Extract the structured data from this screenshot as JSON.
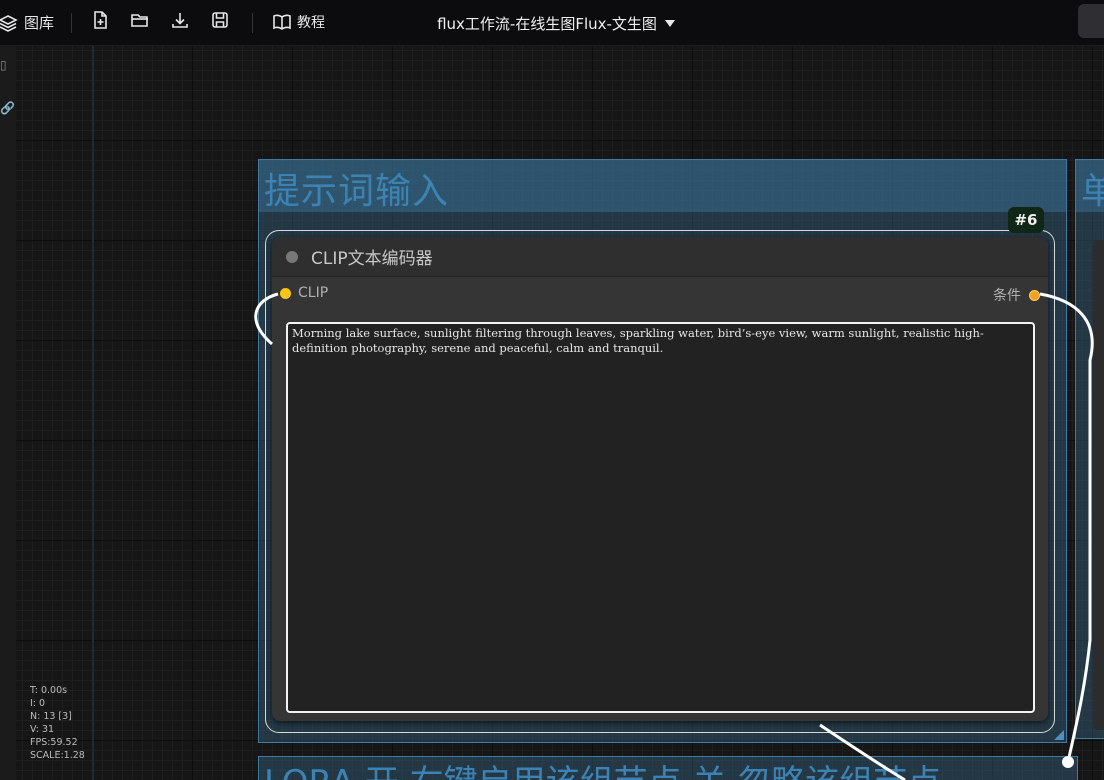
{
  "topbar": {
    "library_label": "图库",
    "tutorial_label": "教程",
    "workflow_title": "flux工作流-在线生图Flux-文生图",
    "right_button_label": "☰"
  },
  "groups": {
    "prompt_input": "提示词输入",
    "right_partial": "单",
    "lora_partial": "LORA  开 右键启用该组节点  关 忽略该组节点"
  },
  "node": {
    "id_badge": "#6",
    "title": "CLIP文本编码器",
    "input_label": "CLIP",
    "output_label": "条件",
    "prompt_text": "Morning lake surface, sunlight filtering through leaves, sparkling water, bird’s-eye view, warm sunlight, realistic high-definition photography, serene and peaceful, calm and tranquil."
  },
  "stats": {
    "time": "T: 0.00s",
    "i": "I: 0",
    "n": "N: 13 [3]",
    "v": "V: 31",
    "fps": "FPS:59.52",
    "scale": "SCALE:1.28"
  },
  "colors": {
    "group_fill": "#325f7d",
    "group_title": "#3c83b4",
    "clip_slot": "#f5c518",
    "conditioning_slot": "#f5a020"
  },
  "icons": [
    "layers-icon",
    "new-file-icon",
    "folder-open-icon",
    "download-icon",
    "save-icon",
    "book-icon",
    "caret-down-icon"
  ]
}
